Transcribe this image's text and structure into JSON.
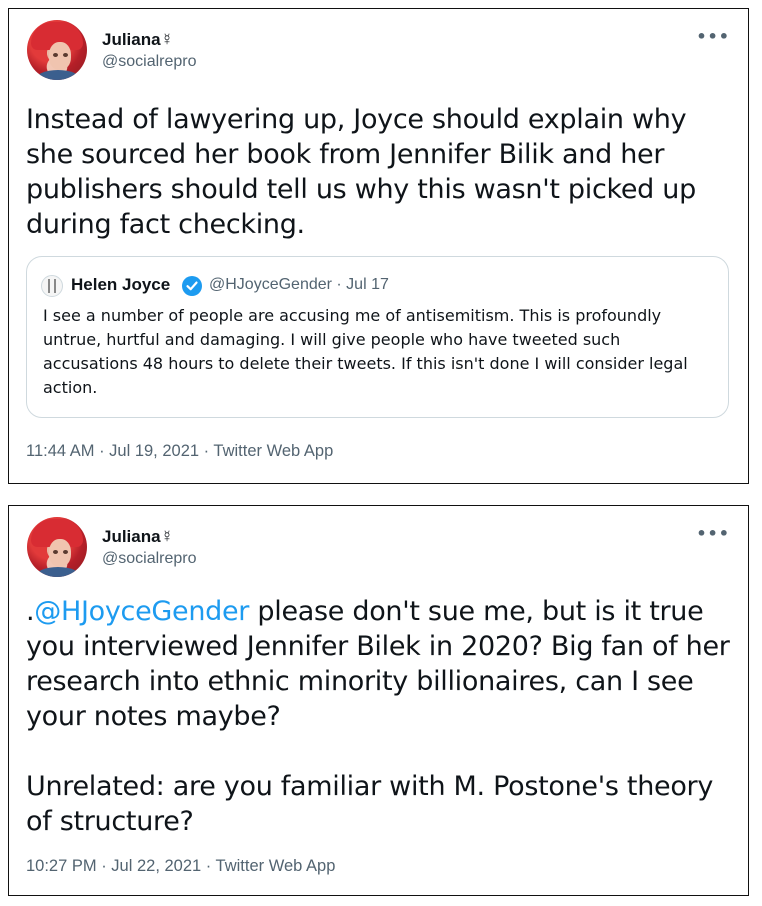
{
  "tweet1": {
    "author_name": "Juliana☿",
    "author_handle": "@socialrepro",
    "more_icon": "more-options-icon",
    "text": "Instead of lawyering up, Joyce should explain why she sourced her book from Jennifer Bilik and her publishers should tell us why this wasn't picked up during fact checking.",
    "quote": {
      "author_name": "Helen Joyce",
      "verified": true,
      "handle_date": "@HJoyceGender · Jul 17",
      "text": "I see a number of people are accusing me of antisemitism. This is profoundly untrue, hurtful and damaging. I will give people who have tweeted such accusations 48 hours to delete their tweets. If this isn't done I will consider legal action."
    },
    "meta": "11:44 AM · Jul 19, 2021 · Twitter Web App"
  },
  "tweet2": {
    "author_name": "Juliana☿",
    "author_handle": "@socialrepro",
    "more_icon": "more-options-icon",
    "text_prefix": ".",
    "mention": "@HJoyceGender",
    "text_rest": " please don't sue me, but is it true you interviewed Jennifer Bilek in 2020? Big fan of her research into ethnic minority billionaires, can I see your notes maybe?",
    "text_para2": "Unrelated: are you familiar with M. Postone's theory of structure?",
    "meta": "10:27 PM · Jul 22, 2021 · Twitter Web App"
  },
  "colors": {
    "accent": "#1d9bf0",
    "secondary_text": "#536471",
    "border": "#cfd9de"
  }
}
